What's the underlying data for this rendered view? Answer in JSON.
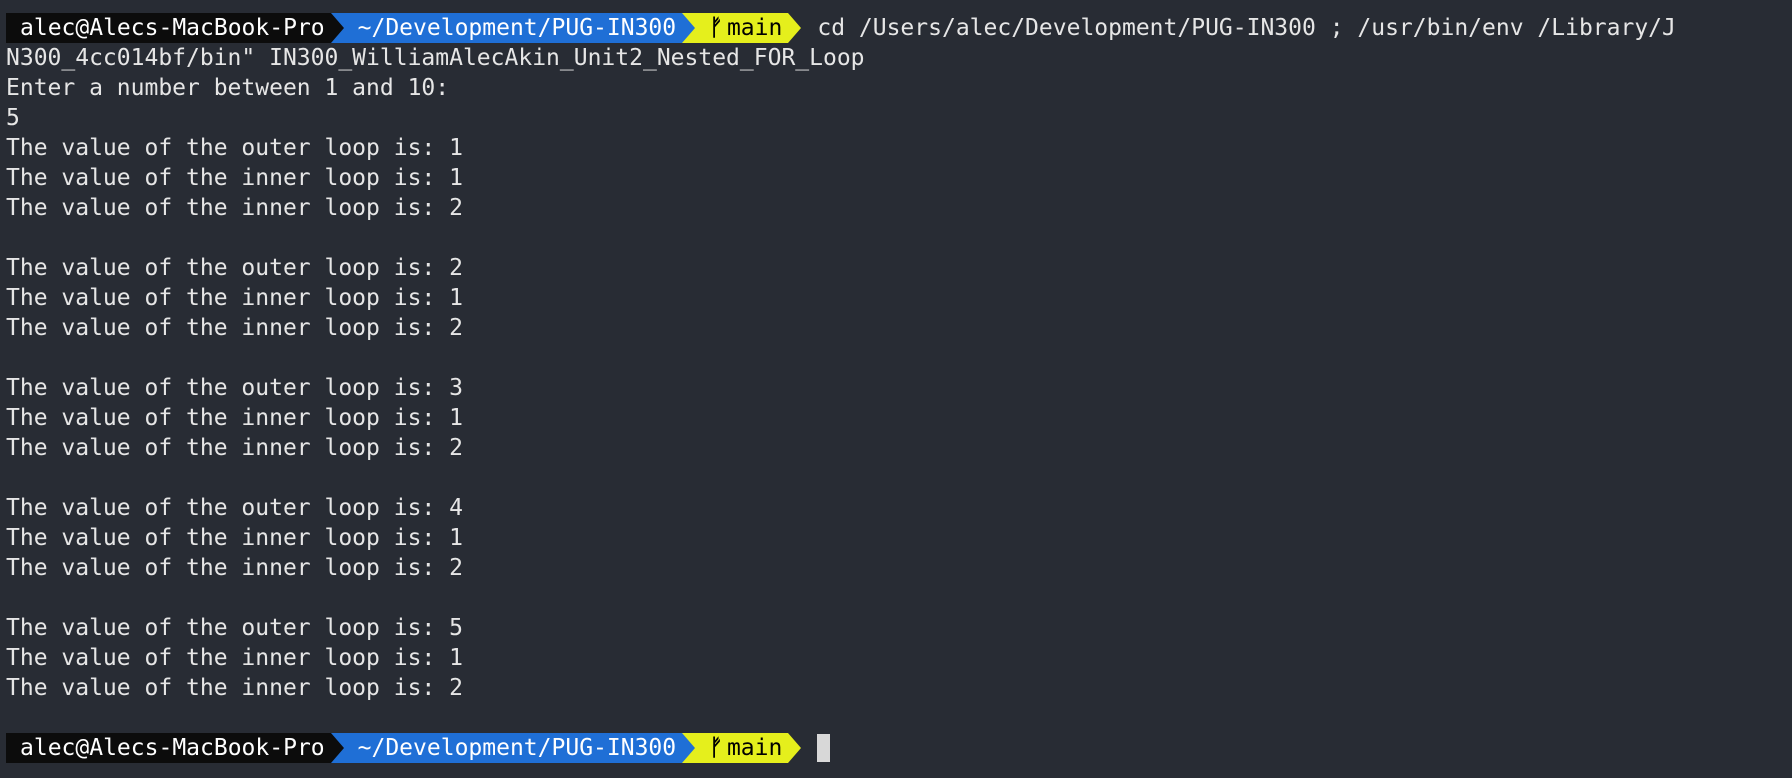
{
  "prompt": {
    "user_host": "alec@Alecs-MacBook-Pro",
    "path": "~/Development/PUG-IN300",
    "branch_icon": "ᚠ",
    "branch": "main"
  },
  "command": {
    "line1": "cd /Users/alec/Development/PUG-IN300 ; /usr/bin/env /Library/J",
    "line2": "N300_4cc014bf/bin\" IN300_WilliamAlecAkin_Unit2_Nested_FOR_Loop"
  },
  "output": {
    "prompt_text": "Enter a number between 1 and 10:",
    "input_value": "5",
    "blocks": [
      [
        "The value of the outer loop is: 1",
        "The value of the inner loop is: 1",
        "The value of the inner loop is: 2"
      ],
      [
        "The value of the outer loop is: 2",
        "The value of the inner loop is: 1",
        "The value of the inner loop is: 2"
      ],
      [
        "The value of the outer loop is: 3",
        "The value of the inner loop is: 1",
        "The value of the inner loop is: 2"
      ],
      [
        "The value of the outer loop is: 4",
        "The value of the inner loop is: 1",
        "The value of the inner loop is: 2"
      ],
      [
        "The value of the outer loop is: 5",
        "The value of the inner loop is: 1",
        "The value of the inner loop is: 2"
      ]
    ]
  },
  "colors": {
    "background": "#282c34",
    "user_segment": "#0c0c0c",
    "path_segment": "#1f6fd6",
    "git_segment": "#e5ef1c",
    "text": "#e6e6e6"
  }
}
